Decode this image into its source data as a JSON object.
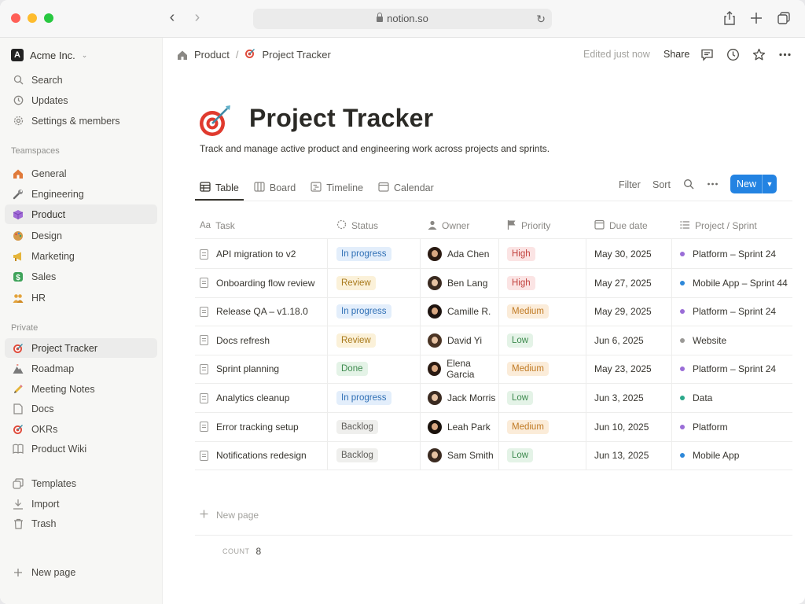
{
  "browser": {
    "url": "notion.so"
  },
  "sidebar": {
    "workspace": "Acme Inc.",
    "top_items": [
      {
        "label": "Search",
        "icon": "search-icon"
      },
      {
        "label": "Updates",
        "icon": "clock-icon"
      },
      {
        "label": "Settings & members",
        "icon": "gear-icon"
      }
    ],
    "teamspaces_label": "Teamspaces",
    "teamspaces": [
      {
        "label": "General",
        "icon": "house-icon",
        "color": "#e07a3a"
      },
      {
        "label": "Engineering",
        "icon": "wrench-icon",
        "color": "#6b6b6b"
      },
      {
        "label": "Product",
        "icon": "cube-icon",
        "color": "#a06ad6",
        "active": true
      },
      {
        "label": "Design",
        "icon": "palette-icon",
        "color": "#d49a4a"
      },
      {
        "label": "Marketing",
        "icon": "megaphone-icon",
        "color": "#e5b53a"
      },
      {
        "label": "Sales",
        "icon": "dollar-icon",
        "color": "#3fa35a"
      },
      {
        "label": "HR",
        "icon": "people-icon",
        "color": "#e3a23a"
      }
    ],
    "private_label": "Private",
    "private": [
      {
        "label": "Project Tracker",
        "icon": "target-icon",
        "active": true
      },
      {
        "label": "Roadmap",
        "icon": "mountain-icon"
      },
      {
        "label": "Meeting Notes",
        "icon": "pencil-icon"
      },
      {
        "label": "Docs",
        "icon": "doc-icon"
      },
      {
        "label": "OKRs",
        "icon": "target-icon"
      },
      {
        "label": "Product Wiki",
        "icon": "book-icon"
      }
    ],
    "bottom_items": [
      {
        "label": "Templates",
        "icon": "templates-icon"
      },
      {
        "label": "Import",
        "icon": "import-icon"
      },
      {
        "label": "Trash",
        "icon": "trash-icon"
      }
    ],
    "new_page": "New page"
  },
  "topbar": {
    "breadcrumb": [
      "Product",
      "Project Tracker"
    ],
    "breadcrumb_sep": "/",
    "edited": "Edited just now",
    "share": "Share"
  },
  "page": {
    "title": "Project Tracker",
    "description": "Track and manage active product and engineering work across projects and sprints."
  },
  "views": [
    {
      "label": "Table",
      "icon": "table-icon",
      "active": true
    },
    {
      "label": "Board",
      "icon": "board-icon"
    },
    {
      "label": "Timeline",
      "icon": "timeline-icon"
    },
    {
      "label": "Calendar",
      "icon": "calendar-icon"
    }
  ],
  "toolbar": {
    "filter": "Filter",
    "sort": "Sort",
    "new": "New"
  },
  "columns": [
    {
      "label": "Task",
      "icon": "Aa"
    },
    {
      "label": "Status",
      "icon": "status-icon"
    },
    {
      "label": "Owner",
      "icon": "person-icon"
    },
    {
      "label": "Priority",
      "icon": "flag-icon"
    },
    {
      "label": "Due date",
      "icon": "calendar-icon"
    },
    {
      "label": "Project / Sprint",
      "icon": "list-icon"
    }
  ],
  "rows": [
    {
      "task": "API migration to v2",
      "status": "In progress",
      "owner": "Ada Chen",
      "priority": "High",
      "due": "May 30, 2025",
      "project": "Platform – Sprint 24",
      "project_color": "#9a6dd7"
    },
    {
      "task": "Onboarding flow review",
      "status": "Review",
      "owner": "Ben Lang",
      "priority": "High",
      "due": "May 27, 2025",
      "project": "Mobile App – Sprint 44",
      "project_color": "#2e88d9"
    },
    {
      "task": "Release QA – v1.18.0",
      "status": "In progress",
      "owner": "Camille R.",
      "priority": "Medium",
      "due": "May 29, 2025",
      "project": "Platform – Sprint 24",
      "project_color": "#9a6dd7"
    },
    {
      "task": "Docs refresh",
      "status": "Review",
      "owner": "David Yi",
      "priority": "Low",
      "due": "Jun 6, 2025",
      "project": "Website",
      "project_color": "#9b9a97"
    },
    {
      "task": "Sprint planning",
      "status": "Done",
      "owner": "Elena Garcia",
      "priority": "Medium",
      "due": "May 23, 2025",
      "project": "Platform – Sprint 24",
      "project_color": "#9a6dd7"
    },
    {
      "task": "Analytics cleanup",
      "status": "In progress",
      "owner": "Jack Morris",
      "priority": "Low",
      "due": "Jun 3, 2025",
      "project": "Data",
      "project_color": "#2ba88a"
    },
    {
      "task": "Error tracking setup",
      "status": "Backlog",
      "owner": "Leah Park",
      "priority": "Medium",
      "due": "Jun 10, 2025",
      "project": "Platform",
      "project_color": "#9a6dd7"
    },
    {
      "task": "Notifications redesign",
      "status": "Backlog",
      "owner": "Sam Smith",
      "priority": "Low",
      "due": "Jun 13, 2025",
      "project": "Mobile App",
      "project_color": "#2e88d9"
    }
  ],
  "status_colors": {
    "In progress": {
      "bg": "#e3eefb",
      "fg": "#2f6fb5"
    },
    "Review": {
      "bg": "#fbf1d9",
      "fg": "#a8791b"
    },
    "Done": {
      "bg": "#e4f3e7",
      "fg": "#3d8a4e"
    },
    "Backlog": {
      "bg": "#efefed",
      "fg": "#5f5e5a"
    }
  },
  "priority_colors": {
    "High": {
      "bg": "#fbe4e4",
      "fg": "#c2423e"
    },
    "Medium": {
      "bg": "#fbecd9",
      "fg": "#c07a24"
    },
    "Low": {
      "bg": "#e4f3e7",
      "fg": "#3d8a4e"
    }
  },
  "footer": {
    "new_page": "New page",
    "count_label": "COUNT",
    "count": "8"
  },
  "accent": "#2383e2"
}
